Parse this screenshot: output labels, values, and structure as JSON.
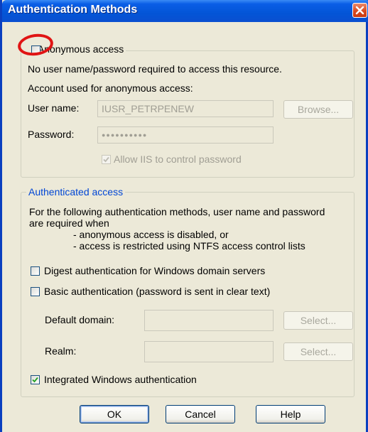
{
  "window": {
    "title": "Authentication Methods"
  },
  "anonymous": {
    "label": "Anonymous access",
    "checked": false,
    "description": "No user name/password required to access this resource.",
    "account_heading": "Account used for anonymous access:",
    "user_name_label": "User name:",
    "user_name_value": "IUSR_PETRPENEW",
    "password_label": "Password:",
    "password_value": "●●●●●●●●●●",
    "browse_label": "Browse...",
    "allow_iis_label": "Allow IIS to control password",
    "allow_iis_checked": true
  },
  "authenticated": {
    "legend": "Authenticated access",
    "desc_line1": "For the following authentication methods, user name and password",
    "desc_line2": "are required when",
    "desc_line3": "- anonymous access is disabled, or",
    "desc_line4": "- access is restricted using NTFS access control lists",
    "digest_label": "Digest authentication for Windows domain servers",
    "digest_checked": false,
    "basic_label": "Basic authentication (password is sent in clear text)",
    "basic_checked": false,
    "default_domain_label": "Default domain:",
    "default_domain_value": "",
    "realm_label": "Realm:",
    "realm_value": "",
    "select_label": "Select...",
    "integrated_label": "Integrated Windows authentication",
    "integrated_checked": true
  },
  "buttons": {
    "ok": "OK",
    "cancel": "Cancel",
    "help": "Help"
  },
  "colors": {
    "title_bar": "#0355d7",
    "close_button": "#d94a1f",
    "highlight": "#e01414",
    "group_legend": "#0046d5"
  },
  "icons": {
    "close": "close-icon",
    "check": "checkmark-icon"
  }
}
